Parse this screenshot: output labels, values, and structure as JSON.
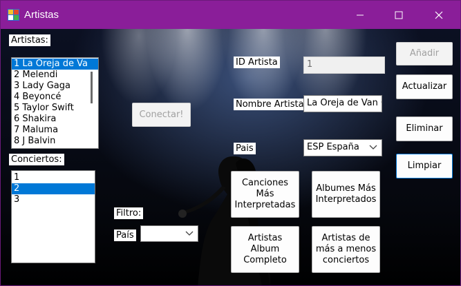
{
  "window": {
    "title": "Artistas"
  },
  "labels": {
    "artistas": "Artistas:",
    "conciertos": "Conciertos:",
    "id_artista": "ID Artista",
    "nombre_artista": "Nombre Artista",
    "pais": "Pais",
    "filtro": "Filtro:",
    "filtro_pais": "País"
  },
  "artistas_list": {
    "items": [
      {
        "text": "1 La Oreja de Va",
        "selected": true
      },
      {
        "text": "2 Melendi",
        "selected": false
      },
      {
        "text": "3 Lady Gaga",
        "selected": false
      },
      {
        "text": "4 Beyoncé",
        "selected": false
      },
      {
        "text": "5 Taylor Swift",
        "selected": false
      },
      {
        "text": "6 Shakira",
        "selected": false
      },
      {
        "text": "7 Maluma",
        "selected": false
      },
      {
        "text": "8 J Balvin",
        "selected": false
      }
    ]
  },
  "conciertos_list": {
    "items": [
      {
        "text": "1",
        "selected": false
      },
      {
        "text": "2",
        "selected": true
      },
      {
        "text": "3",
        "selected": false
      }
    ]
  },
  "fields": {
    "id_artista_value": "1",
    "nombre_artista_value": "La Oreja de Van G",
    "pais_value": "ESP España",
    "filtro_pais_value": ""
  },
  "buttons": {
    "conectar": "Conectar!",
    "anadir": "Añadir",
    "actualizar": "Actualizar",
    "eliminar": "Eliminar",
    "limpiar": "Limpiar",
    "canciones": "Canciones Más Interpretadas",
    "albumes": "Albumes Más Interpretados",
    "artistas_album": "Artistas Album Completo",
    "artistas_conciertos": "Artistas de más a menos conciertos"
  },
  "colors": {
    "titlebar": "#8a1e99",
    "selection": "#0078d7"
  }
}
